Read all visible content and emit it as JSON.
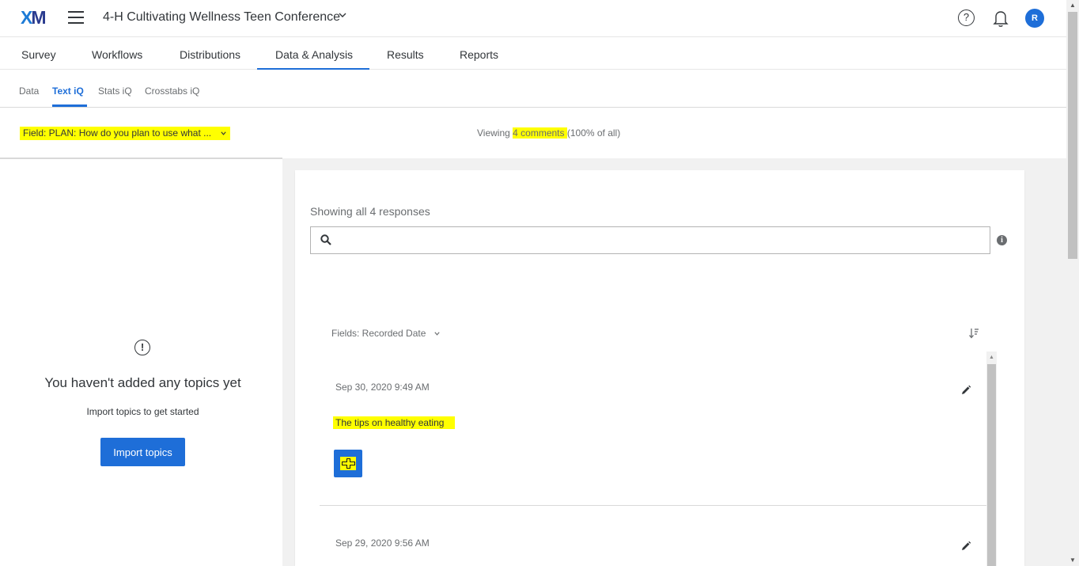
{
  "app": {
    "logo_x": "X",
    "logo_m": "M",
    "project_title": "4-H Cultivating Wellness Teen Conference",
    "avatar_initial": "R",
    "help_glyph": "?"
  },
  "main_tabs": [
    {
      "label": "Survey"
    },
    {
      "label": "Workflows"
    },
    {
      "label": "Distributions"
    },
    {
      "label": "Data & Analysis",
      "active": true
    },
    {
      "label": "Results"
    },
    {
      "label": "Reports"
    }
  ],
  "sub_tabs": [
    {
      "label": "Data"
    },
    {
      "label": "Text iQ",
      "active": true
    },
    {
      "label": "Stats iQ"
    },
    {
      "label": "Crosstabs iQ"
    }
  ],
  "field_bar": {
    "field_label": "Field:  PLAN: How do you plan to use what ...",
    "viewing_prefix": "Viewing ",
    "viewing_count": "4 comments ",
    "viewing_suffix": "(100% of all)"
  },
  "topics_panel": {
    "title": "You haven't added any topics yet",
    "subtitle": "Import topics to get started",
    "import_button": "Import topics"
  },
  "responses": {
    "showing_label": "Showing all 4 responses",
    "search_placeholder": "",
    "fields_label": "Fields: Recorded Date",
    "items": [
      {
        "date": "Sep 30, 2020 9:49 AM",
        "text": "The tips on healthy eating"
      },
      {
        "date": "Sep 29, 2020 9:56 AM",
        "text": ""
      }
    ]
  },
  "colors": {
    "accent": "#1e6ed8",
    "highlight": "#ffff00",
    "grey_bg": "#f1f1f1"
  },
  "icons": [
    "hamburger-icon",
    "chevron-down-icon",
    "help-icon",
    "bell-icon",
    "alert-icon",
    "search-icon",
    "info-icon",
    "sort-icon",
    "edit-icon",
    "plus-icon"
  ]
}
